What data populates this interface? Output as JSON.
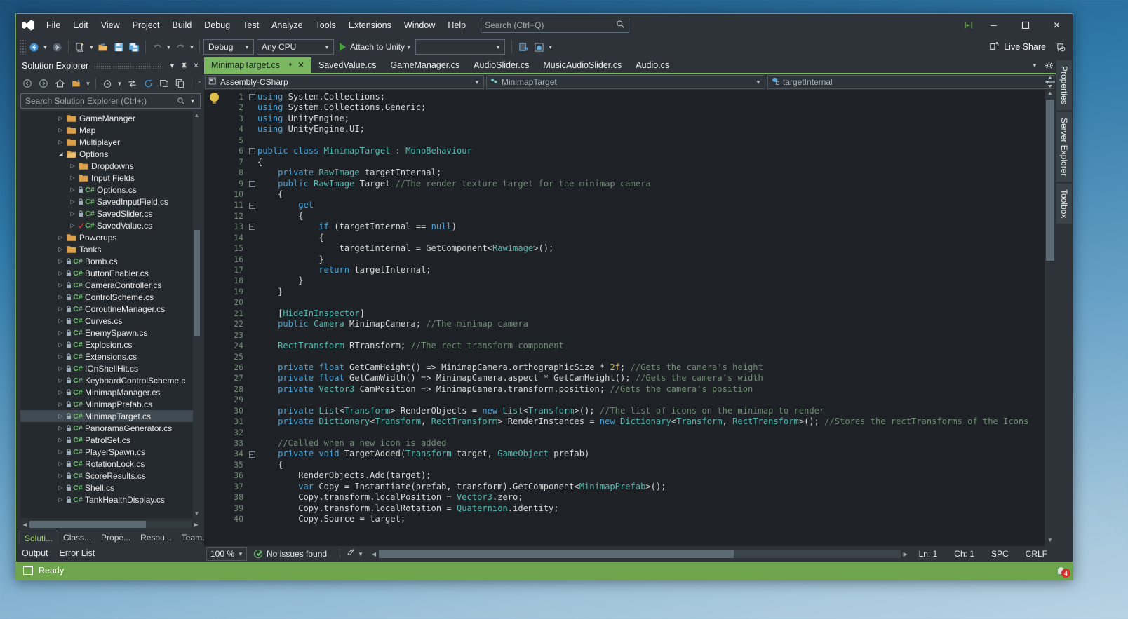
{
  "window": {
    "menu": [
      "File",
      "Edit",
      "View",
      "Project",
      "Build",
      "Debug",
      "Test",
      "Analyze",
      "Tools",
      "Extensions",
      "Window",
      "Help"
    ],
    "search_placeholder": "Search (Ctrl+Q)",
    "live_share": "Live Share",
    "minimize": "─",
    "maximize": "☐",
    "close": "✕"
  },
  "toolbar": {
    "config": "Debug",
    "platform": "Any CPU",
    "run_label": "Attach to Unity",
    "target_value": ""
  },
  "solution_explorer": {
    "title": "Solution Explorer",
    "search_placeholder": "Search Solution Explorer (Ctrl+;)",
    "tree": [
      {
        "label": "GameManager",
        "type": "folder",
        "indent": 3,
        "expander": "▷",
        "selected": false
      },
      {
        "label": "Map",
        "type": "folder",
        "indent": 3,
        "expander": "▷",
        "selected": false
      },
      {
        "label": "Multiplayer",
        "type": "folder",
        "indent": 3,
        "expander": "▷",
        "selected": false
      },
      {
        "label": "Options",
        "type": "folder-open",
        "indent": 3,
        "expander": "◢",
        "selected": false
      },
      {
        "label": "Dropdowns",
        "type": "folder",
        "indent": 4,
        "expander": "▷",
        "selected": false
      },
      {
        "label": "Input Fields",
        "type": "folder",
        "indent": 4,
        "expander": "▷",
        "selected": false
      },
      {
        "label": "Options.cs",
        "type": "cs",
        "indent": 4,
        "expander": "▷",
        "selected": false
      },
      {
        "label": "SavedInputField.cs",
        "type": "cs",
        "indent": 4,
        "expander": "▷",
        "selected": false
      },
      {
        "label": "SavedSlider.cs",
        "type": "cs",
        "indent": 4,
        "expander": "▷",
        "selected": false
      },
      {
        "label": "SavedValue.cs",
        "type": "cs-check",
        "indent": 4,
        "expander": "▷",
        "selected": false
      },
      {
        "label": "Powerups",
        "type": "folder",
        "indent": 3,
        "expander": "▷",
        "selected": false
      },
      {
        "label": "Tanks",
        "type": "folder",
        "indent": 3,
        "expander": "▷",
        "selected": false
      },
      {
        "label": "Bomb.cs",
        "type": "cs",
        "indent": 3,
        "expander": "▷",
        "selected": false
      },
      {
        "label": "ButtonEnabler.cs",
        "type": "cs",
        "indent": 3,
        "expander": "▷",
        "selected": false
      },
      {
        "label": "CameraController.cs",
        "type": "cs",
        "indent": 3,
        "expander": "▷",
        "selected": false
      },
      {
        "label": "ControlScheme.cs",
        "type": "cs",
        "indent": 3,
        "expander": "▷",
        "selected": false
      },
      {
        "label": "CoroutineManager.cs",
        "type": "cs",
        "indent": 3,
        "expander": "▷",
        "selected": false
      },
      {
        "label": "Curves.cs",
        "type": "cs",
        "indent": 3,
        "expander": "▷",
        "selected": false
      },
      {
        "label": "EnemySpawn.cs",
        "type": "cs",
        "indent": 3,
        "expander": "▷",
        "selected": false
      },
      {
        "label": "Explosion.cs",
        "type": "cs",
        "indent": 3,
        "expander": "▷",
        "selected": false
      },
      {
        "label": "Extensions.cs",
        "type": "cs",
        "indent": 3,
        "expander": "▷",
        "selected": false
      },
      {
        "label": "IOnShellHit.cs",
        "type": "cs",
        "indent": 3,
        "expander": "▷",
        "selected": false
      },
      {
        "label": "KeyboardControlScheme.c",
        "type": "cs",
        "indent": 3,
        "expander": "▷",
        "selected": false
      },
      {
        "label": "MinimapManager.cs",
        "type": "cs",
        "indent": 3,
        "expander": "▷",
        "selected": false
      },
      {
        "label": "MinimapPrefab.cs",
        "type": "cs",
        "indent": 3,
        "expander": "▷",
        "selected": false
      },
      {
        "label": "MinimapTarget.cs",
        "type": "cs",
        "indent": 3,
        "expander": "▷",
        "selected": true
      },
      {
        "label": "PanoramaGenerator.cs",
        "type": "cs",
        "indent": 3,
        "expander": "▷",
        "selected": false
      },
      {
        "label": "PatrolSet.cs",
        "type": "cs",
        "indent": 3,
        "expander": "▷",
        "selected": false
      },
      {
        "label": "PlayerSpawn.cs",
        "type": "cs",
        "indent": 3,
        "expander": "▷",
        "selected": false
      },
      {
        "label": "RotationLock.cs",
        "type": "cs",
        "indent": 3,
        "expander": "▷",
        "selected": false
      },
      {
        "label": "ScoreResults.cs",
        "type": "cs",
        "indent": 3,
        "expander": "▷",
        "selected": false
      },
      {
        "label": "Shell.cs",
        "type": "cs",
        "indent": 3,
        "expander": "▷",
        "selected": false
      },
      {
        "label": "TankHealthDisplay.cs",
        "type": "cs",
        "indent": 3,
        "expander": "▷",
        "selected": false
      }
    ],
    "bottom_tabs": [
      {
        "label": "Soluti...",
        "active": true
      },
      {
        "label": "Class...",
        "active": false
      },
      {
        "label": "Prope...",
        "active": false
      },
      {
        "label": "Resou...",
        "active": false
      },
      {
        "label": "Team...",
        "active": false
      }
    ],
    "output_tabs": [
      "Output",
      "Error List"
    ]
  },
  "editor": {
    "tabs": [
      {
        "label": "MinimapTarget.cs",
        "active": true
      },
      {
        "label": "SavedValue.cs",
        "active": false
      },
      {
        "label": "GameManager.cs",
        "active": false
      },
      {
        "label": "AudioSlider.cs",
        "active": false
      },
      {
        "label": "MusicAudioSlider.cs",
        "active": false
      },
      {
        "label": "Audio.cs",
        "active": false
      }
    ],
    "nav": {
      "project": "Assembly-CSharp",
      "type": "MinimapTarget",
      "member": "targetInternal"
    },
    "first_line": 1,
    "last_line": 40,
    "status": {
      "zoom": "100 %",
      "issues": "No issues found",
      "line": "Ln: 1",
      "col": "Ch: 1",
      "spaces": "SPC",
      "eol": "CRLF"
    }
  },
  "right_rail": [
    "Properties",
    "Server Explorer",
    "Toolbox"
  ],
  "statusbar": {
    "ready": "Ready",
    "notification_count": "4"
  },
  "code_lines": [
    [
      [
        "kw",
        "using"
      ],
      [
        "idf",
        " System.Collections;"
      ]
    ],
    [
      [
        "kw",
        "using"
      ],
      [
        "idf",
        " System.Collections.Generic;"
      ]
    ],
    [
      [
        "kw",
        "using"
      ],
      [
        "idf",
        " UnityEngine;"
      ]
    ],
    [
      [
        "kw",
        "using"
      ],
      [
        "idf",
        " UnityEngine.UI;"
      ]
    ],
    [],
    [
      [
        "kw",
        "public class "
      ],
      [
        "ty",
        "MinimapTarget"
      ],
      [
        "idf",
        " : "
      ],
      [
        "ty",
        "MonoBehaviour"
      ]
    ],
    [
      [
        "idf",
        "{"
      ]
    ],
    [
      [
        "idf",
        "    "
      ],
      [
        "kw",
        "private "
      ],
      [
        "ty",
        "RawImage"
      ],
      [
        "idf",
        " targetInternal;"
      ]
    ],
    [
      [
        "idf",
        "    "
      ],
      [
        "kw",
        "public "
      ],
      [
        "ty",
        "RawImage"
      ],
      [
        "idf",
        " Target "
      ],
      [
        "cmt",
        "//The render texture target for the minimap camera"
      ]
    ],
    [
      [
        "idf",
        "    {"
      ]
    ],
    [
      [
        "idf",
        "        "
      ],
      [
        "kw",
        "get"
      ]
    ],
    [
      [
        "idf",
        "        {"
      ]
    ],
    [
      [
        "idf",
        "            "
      ],
      [
        "kw",
        "if"
      ],
      [
        "idf",
        " (targetInternal == "
      ],
      [
        "kw",
        "null"
      ],
      [
        "idf",
        ")"
      ]
    ],
    [
      [
        "idf",
        "            {"
      ]
    ],
    [
      [
        "idf",
        "                targetInternal = GetComponent<"
      ],
      [
        "ty",
        "RawImage"
      ],
      [
        "idf",
        ">();"
      ]
    ],
    [
      [
        "idf",
        "            }"
      ]
    ],
    [
      [
        "idf",
        "            "
      ],
      [
        "kw",
        "return"
      ],
      [
        "idf",
        " targetInternal;"
      ]
    ],
    [
      [
        "idf",
        "        }"
      ]
    ],
    [
      [
        "idf",
        "    }"
      ]
    ],
    [],
    [
      [
        "idf",
        "    ["
      ],
      [
        "ty",
        "HideInInspector"
      ],
      [
        "idf",
        "]"
      ]
    ],
    [
      [
        "idf",
        "    "
      ],
      [
        "kw",
        "public "
      ],
      [
        "ty",
        "Camera"
      ],
      [
        "idf",
        " MinimapCamera; "
      ],
      [
        "cmt",
        "//The minimap camera"
      ]
    ],
    [],
    [
      [
        "idf",
        "    "
      ],
      [
        "ty",
        "RectTransform"
      ],
      [
        "idf",
        " RTransform; "
      ],
      [
        "cmt",
        "//The rect transform component"
      ]
    ],
    [],
    [
      [
        "idf",
        "    "
      ],
      [
        "kw",
        "private "
      ],
      [
        "kw",
        "float"
      ],
      [
        "idf",
        " GetCamHeight() => MinimapCamera.orthographicSize * "
      ],
      [
        "num",
        "2f"
      ],
      [
        "idf",
        "; "
      ],
      [
        "cmt",
        "//Gets the camera's height"
      ]
    ],
    [
      [
        "idf",
        "    "
      ],
      [
        "kw",
        "private "
      ],
      [
        "kw",
        "float"
      ],
      [
        "idf",
        " GetCamWidth() => MinimapCamera.aspect * GetCamHeight(); "
      ],
      [
        "cmt",
        "//Gets the camera's width"
      ]
    ],
    [
      [
        "idf",
        "    "
      ],
      [
        "kw",
        "private "
      ],
      [
        "ty",
        "Vector3"
      ],
      [
        "idf",
        " CamPosition => MinimapCamera.transform.position; "
      ],
      [
        "cmt",
        "//Gets the camera's position"
      ]
    ],
    [],
    [
      [
        "idf",
        "    "
      ],
      [
        "kw",
        "private "
      ],
      [
        "ty",
        "List"
      ],
      [
        "idf",
        "<"
      ],
      [
        "ty",
        "Transform"
      ],
      [
        "idf",
        "> RenderObjects = "
      ],
      [
        "kw",
        "new "
      ],
      [
        "ty",
        "List"
      ],
      [
        "idf",
        "<"
      ],
      [
        "ty",
        "Transform"
      ],
      [
        "idf",
        ">(); "
      ],
      [
        "cmt",
        "//The list of icons on the minimap to render"
      ]
    ],
    [
      [
        "idf",
        "    "
      ],
      [
        "kw",
        "private "
      ],
      [
        "ty",
        "Dictionary"
      ],
      [
        "idf",
        "<"
      ],
      [
        "ty",
        "Transform"
      ],
      [
        "idf",
        ", "
      ],
      [
        "ty",
        "RectTransform"
      ],
      [
        "idf",
        "> RenderInstances = "
      ],
      [
        "kw",
        "new "
      ],
      [
        "ty",
        "Dictionary"
      ],
      [
        "idf",
        "<"
      ],
      [
        "ty",
        "Transform"
      ],
      [
        "idf",
        ", "
      ],
      [
        "ty",
        "RectTransform"
      ],
      [
        "idf",
        ">(); "
      ],
      [
        "cmt",
        "//Stores the rectTransforms of the Icons"
      ]
    ],
    [],
    [
      [
        "idf",
        "    "
      ],
      [
        "cmt",
        "//Called when a new icon is added"
      ]
    ],
    [
      [
        "idf",
        "    "
      ],
      [
        "kw",
        "private "
      ],
      [
        "kw",
        "void"
      ],
      [
        "idf",
        " TargetAdded("
      ],
      [
        "ty",
        "Transform"
      ],
      [
        "idf",
        " target, "
      ],
      [
        "ty",
        "GameObject"
      ],
      [
        "idf",
        " prefab)"
      ]
    ],
    [
      [
        "idf",
        "    {"
      ]
    ],
    [
      [
        "idf",
        "        RenderObjects.Add(target);"
      ]
    ],
    [
      [
        "idf",
        "        "
      ],
      [
        "kw",
        "var"
      ],
      [
        "idf",
        " Copy = Instantiate(prefab, transform).GetComponent<"
      ],
      [
        "ty",
        "MinimapPrefab"
      ],
      [
        "idf",
        ">();"
      ]
    ],
    [
      [
        "idf",
        "        Copy.transform.localPosition = "
      ],
      [
        "ty",
        "Vector3"
      ],
      [
        "idf",
        ".zero;"
      ]
    ],
    [
      [
        "idf",
        "        Copy.transform.localRotation = "
      ],
      [
        "ty",
        "Quaternion"
      ],
      [
        "idf",
        ".identity;"
      ]
    ],
    [
      [
        "idf",
        "        Copy.Source = target;"
      ]
    ]
  ],
  "colors": {
    "accent_green": "#7bb661",
    "status_green": "#6ea44b",
    "chrome": "#2d3339",
    "editor_bg": "#1e2226",
    "keyword_blue": "#4aa3d6",
    "type_teal": "#53b9b0",
    "comment_green": "#6f8b72",
    "number_gold": "#d4b14a"
  }
}
